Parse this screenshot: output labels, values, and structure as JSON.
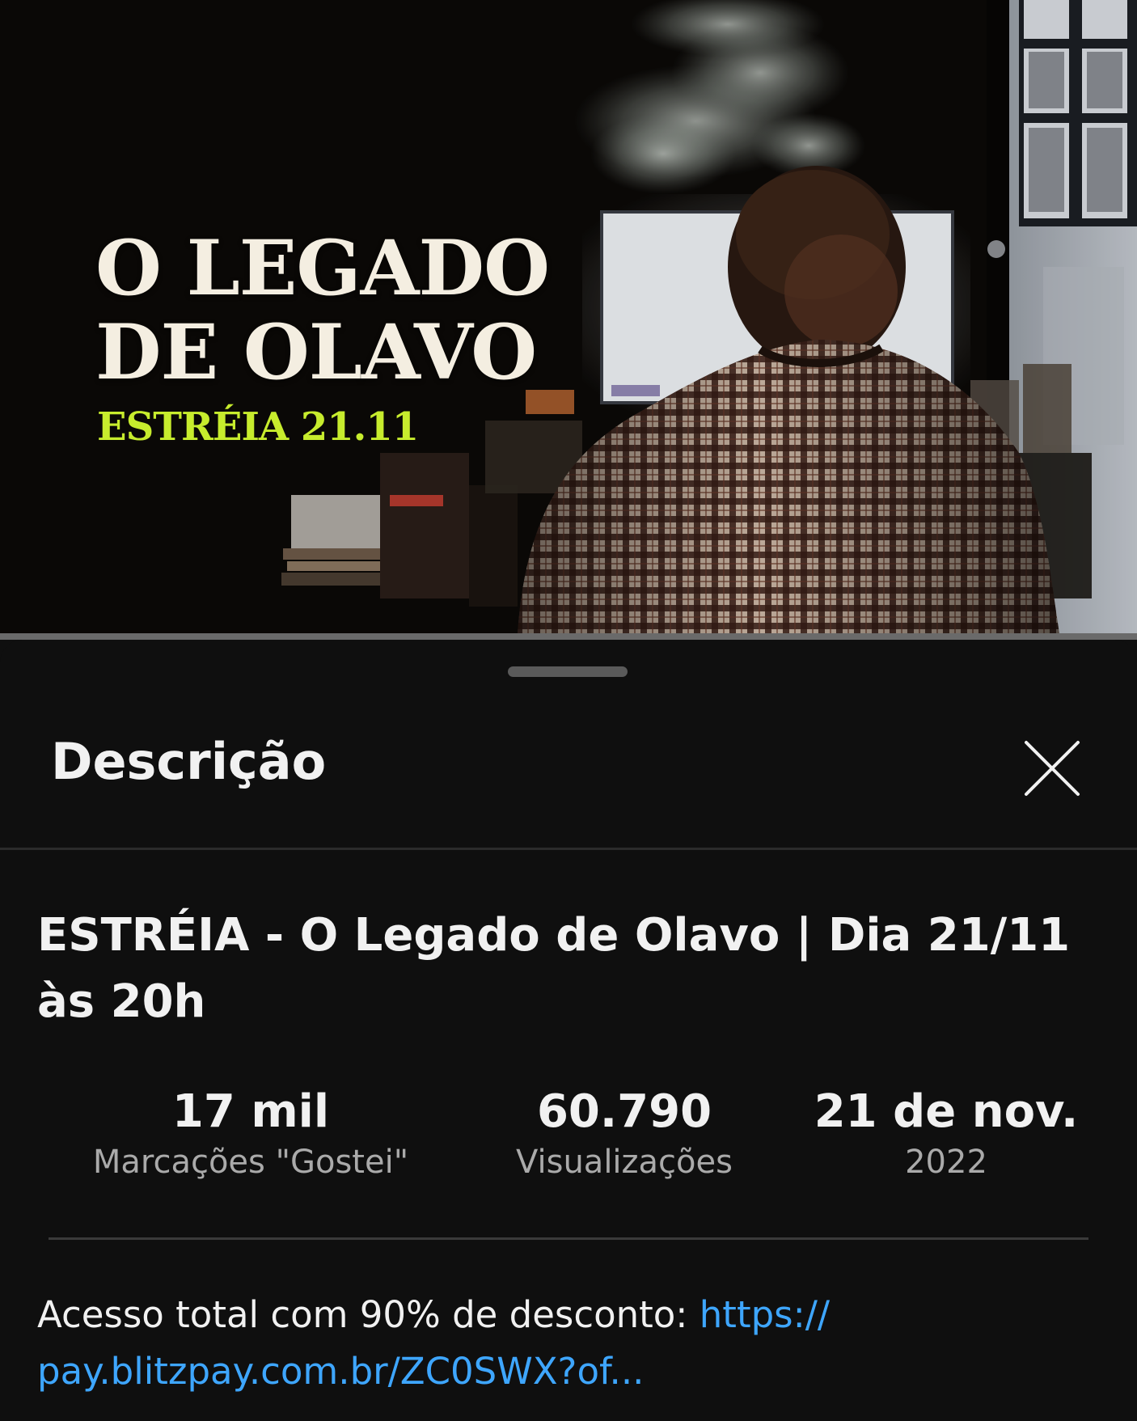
{
  "thumbnail": {
    "title_line1": "O LEGADO",
    "title_line2": "DE OLAVO",
    "subtitle": "ESTRÉIA 21.11",
    "title_color": "#f4eee1",
    "subtitle_color": "#c7ec2d"
  },
  "sheet": {
    "title": "Descrição",
    "close_icon": "close-icon"
  },
  "video": {
    "title": "ESTRÉIA - O Legado de Olavo | Dia 21/11 às 20h"
  },
  "stats": {
    "likes_value": "17 mil",
    "likes_label": "Marcações \"Gostei\"",
    "views_value": "60.790",
    "views_label": "Visualizações",
    "date_value": "21 de nov.",
    "date_year": "2022"
  },
  "description": {
    "text": "Acesso total com 90% de desconto: ",
    "link_line1": "https://",
    "link_line2": "pay.blitzpay.com.br/ZC0SWX?of...",
    "link_color": "#3ea6ff"
  }
}
